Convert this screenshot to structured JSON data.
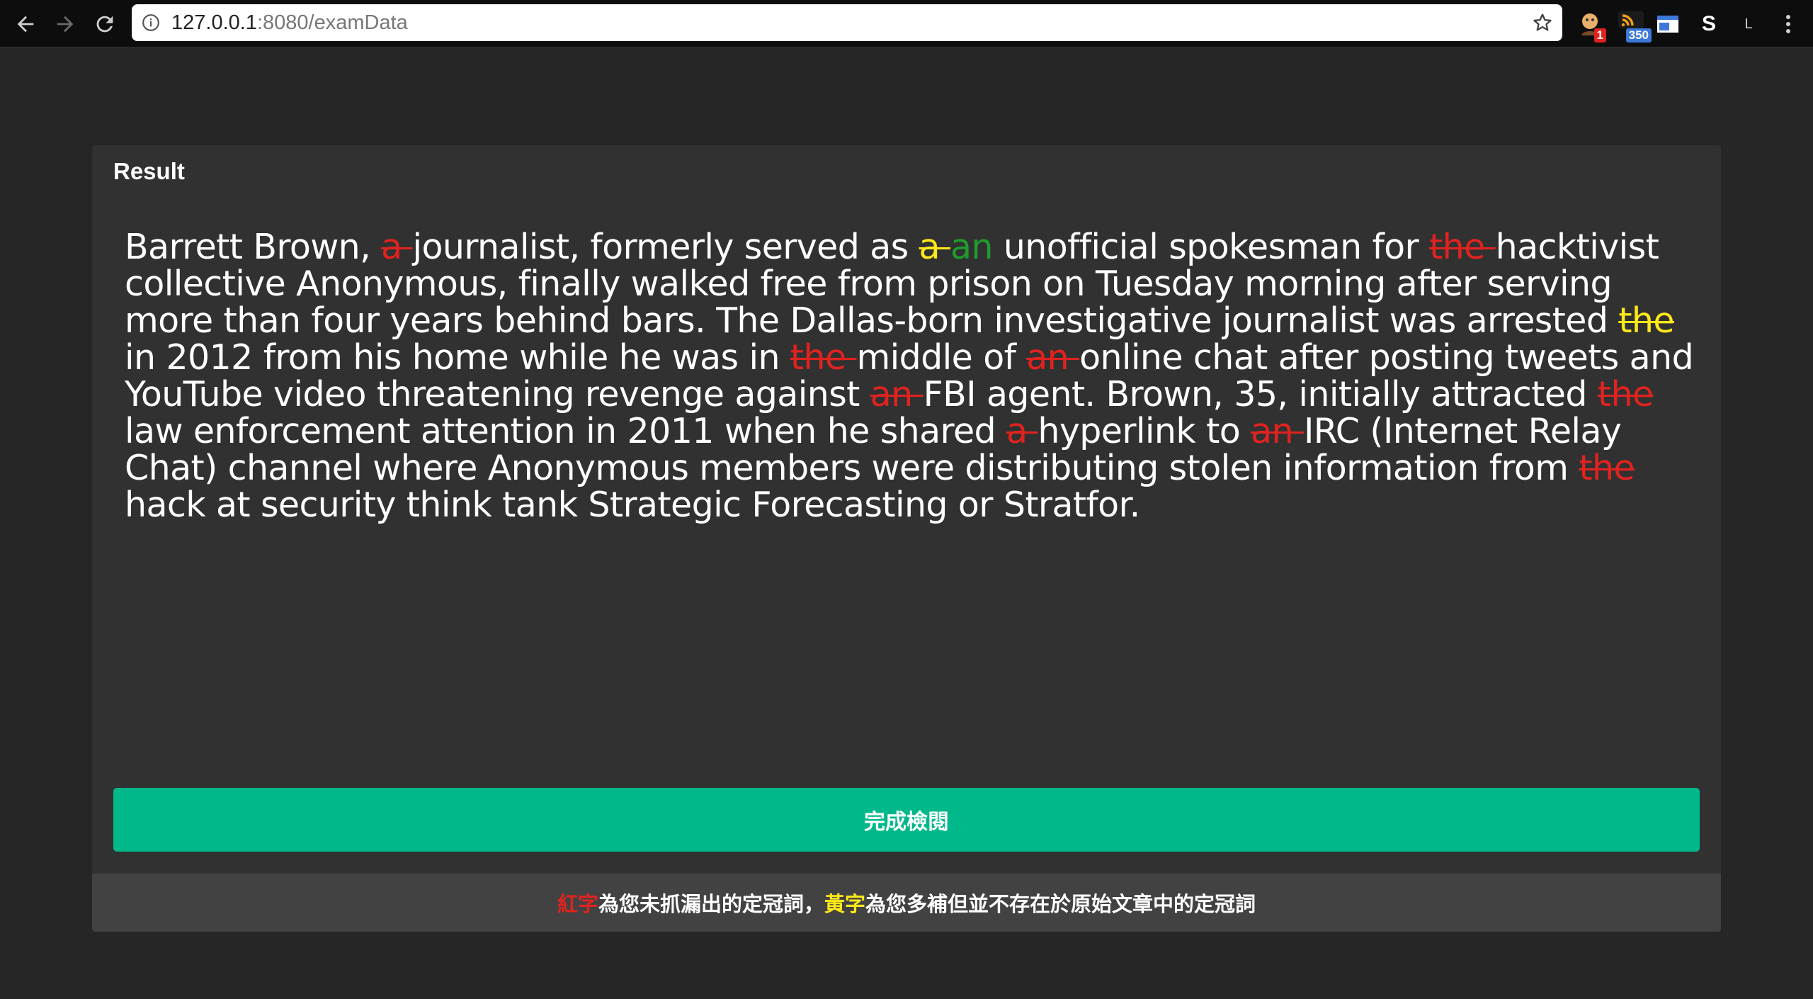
{
  "browser": {
    "url_host": "127.0.0.1",
    "url_path": ":8080/examData",
    "extensions": [
      {
        "icon": "extension-avatar-icon",
        "badge": "1",
        "badge_color": "#e0231f"
      },
      {
        "icon": "rss-feed-icon",
        "badge": "350",
        "badge_color": "#3b78d8"
      },
      {
        "icon": "window-extension-icon"
      },
      {
        "icon": "s-extension-icon",
        "label": "S"
      },
      {
        "icon": "l-extension-icon",
        "label": "L"
      }
    ]
  },
  "card": {
    "title": "Result",
    "submit_label": "完成檢閱",
    "legend": {
      "red_word": "紅字",
      "red_desc": "為您未抓漏出的定冠詞，",
      "yellow_word": "黃字",
      "yellow_desc": "為您多補但並不存在於原始文章中的定冠詞"
    }
  },
  "colors": {
    "missed": "#e0231f",
    "extra": "#ffe81a",
    "correction": "#1f9c2c",
    "button": "#00b88a"
  },
  "article": {
    "segments": [
      {
        "t": "Barrett Brown, "
      },
      {
        "t": "a ",
        "k": "miss"
      },
      {
        "t": "journalist, formerly served as "
      },
      {
        "t": "a ",
        "k": "extra"
      },
      {
        "t": "an",
        "k": "fix"
      },
      {
        "t": " unofficial spokesman for "
      },
      {
        "t": "the ",
        "k": "miss"
      },
      {
        "t": "hacktivist collective Anonymous, finally walked free from prison on Tuesday morning after serving more than four years behind bars. The Dallas-born investigative journalist was arrested "
      },
      {
        "t": "the ",
        "k": "extra"
      },
      {
        "t": "in 2012 from his home while he was in "
      },
      {
        "t": "the ",
        "k": "miss"
      },
      {
        "t": "middle of "
      },
      {
        "t": "an ",
        "k": "miss"
      },
      {
        "t": "online chat after posting tweets and YouTube video threatening revenge against "
      },
      {
        "t": "an ",
        "k": "miss"
      },
      {
        "t": "FBI agent. Brown, 35, initially attracted "
      },
      {
        "t": "the",
        "k": "miss"
      },
      {
        "t": " law enforcement attention in 2011 when he shared "
      },
      {
        "t": "a ",
        "k": "miss"
      },
      {
        "t": "hyperlink to "
      },
      {
        "t": "an ",
        "k": "miss"
      },
      {
        "t": "IRC (Internet Relay Chat) channel where Anonymous members were distributing stolen information from "
      },
      {
        "t": "the",
        "k": "miss"
      },
      {
        "t": " hack at security think tank Strategic Forecasting or Stratfor."
      }
    ]
  }
}
